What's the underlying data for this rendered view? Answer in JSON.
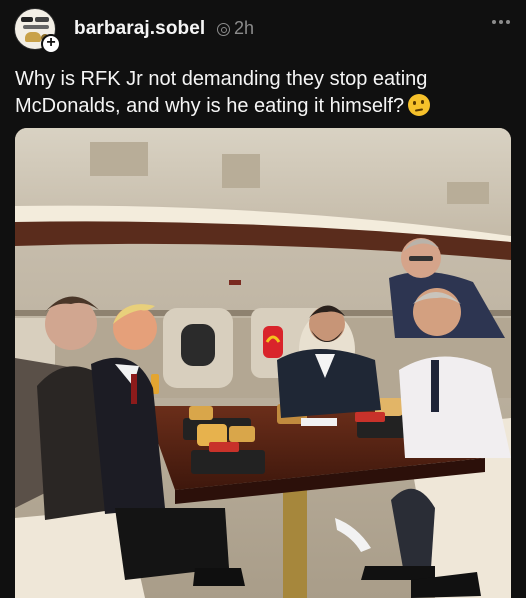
{
  "post": {
    "username": "barbaraj.sobel",
    "time": "2h",
    "text": "Why is RFK Jr not demanding they stop eating McDonalds, and why is he eating it himself?",
    "emoji": "thinking-face",
    "photo": {
      "description_icon": "photo"
    }
  },
  "icons": {
    "more": "more-horizontal-icon",
    "follow": "plus-icon",
    "visibility": "globe-icon"
  },
  "colors": {
    "background": "#101010",
    "text": "#f5f5f5",
    "muted": "#8c8c8c"
  }
}
